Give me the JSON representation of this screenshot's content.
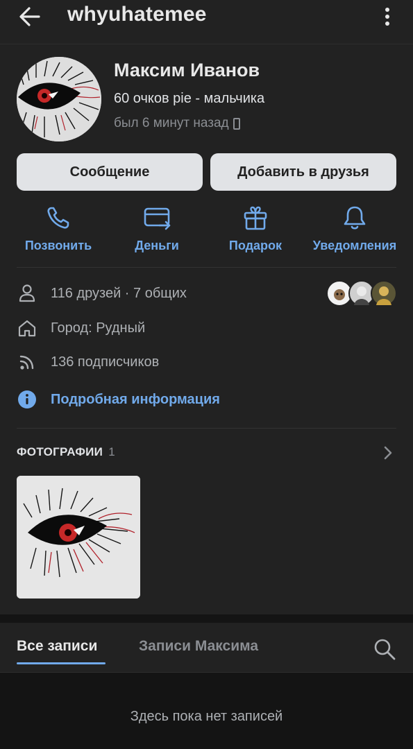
{
  "header": {
    "title": "whyuhatemee",
    "back_icon": "arrow-left-icon",
    "more_icon": "more-vertical-icon"
  },
  "profile": {
    "name": "Максим Иванов",
    "status": "60 очков pie - мальчика",
    "last_seen": "был 6 минут назад",
    "device_icon": "mobile-phone-icon"
  },
  "buttons": {
    "message": "Сообщение",
    "add_friend": "Добавить в друзья"
  },
  "actions": [
    {
      "label": "Позвонить",
      "icon": "phone-icon"
    },
    {
      "label": "Деньги",
      "icon": "money-transfer-icon"
    },
    {
      "label": "Подарок",
      "icon": "gift-icon"
    },
    {
      "label": "Уведомления",
      "icon": "bell-icon"
    }
  ],
  "info": {
    "friends": "116 друзей · 7 общих",
    "city": "Город: Рудный",
    "followers": "136 подписчиков",
    "details_link": "Подробная информация"
  },
  "photos": {
    "title": "ФОТОГРАФИИ",
    "count": "1"
  },
  "wall": {
    "tabs": [
      "Все записи",
      "Записи Максима"
    ],
    "active_tab": "Все записи",
    "empty_text": "Здесь пока нет записей"
  },
  "colors": {
    "background": "#141414",
    "card": "#222222",
    "accent": "#71aaeb",
    "button_bg": "#e1e3e6",
    "muted": "#8b8e93"
  }
}
